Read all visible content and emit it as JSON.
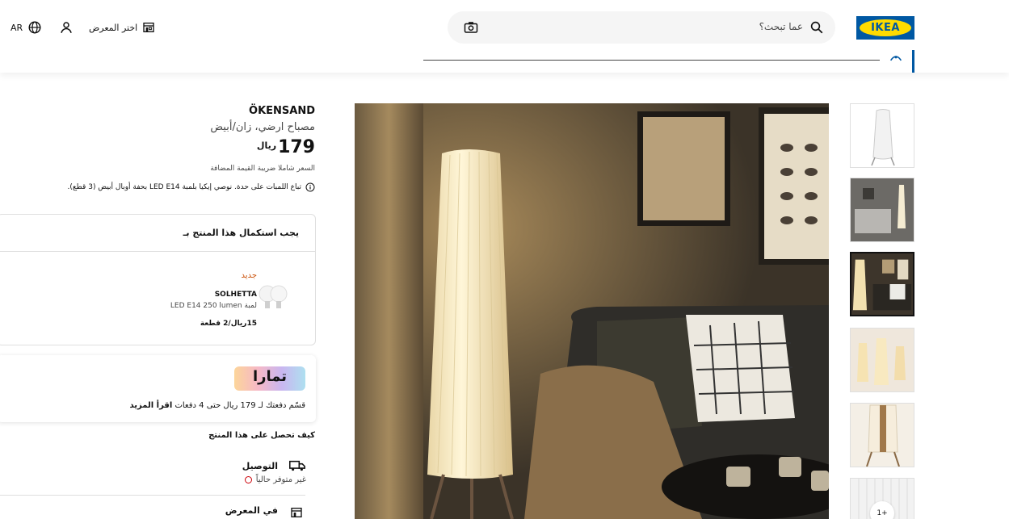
{
  "header": {
    "logo_text": "IKEA",
    "search_placeholder": "عما تبحث؟",
    "store_label": "اختر المعرض",
    "lang": "AR"
  },
  "product": {
    "name": "ÖKENSAND",
    "description": "مصباح ارضي، زان/أبيض",
    "price": "179",
    "currency": "ريال",
    "vat_note": "السعر شاملا ضريبة القيمة المضافة",
    "bulb_note": "تباع اللمبات على حدة. نوصي إيكيا بلمبة LED E14 بحفة أوبال أبيض (3 قطع)."
  },
  "required": {
    "title": "يجب استكمال هذا المنتج بـ",
    "new_badge": "جديد",
    "item_name": "SOLHETTA",
    "item_desc": "لمبة LED E14 250 lumen",
    "item_price": "15ريال/2 قطعة"
  },
  "tamara": {
    "logo": "تمارا",
    "text": "قسّم دفعتك لـ 179 ريال حتى 4 دفعات",
    "link": "اقرأ المزيد"
  },
  "fulfillment": {
    "title": "كيف تحصل على هذا المنتج",
    "delivery_label": "التوصيل",
    "delivery_status": "غير متوفر حالياً",
    "store_label": "في المعرض"
  },
  "gallery": {
    "more_label": "1+",
    "selected_index": 2
  },
  "colors": {
    "brand_blue": "#0058a3",
    "brand_yellow": "#ffdb00",
    "new_orange": "#ca5008",
    "unavailable_red": "#cc0008"
  }
}
